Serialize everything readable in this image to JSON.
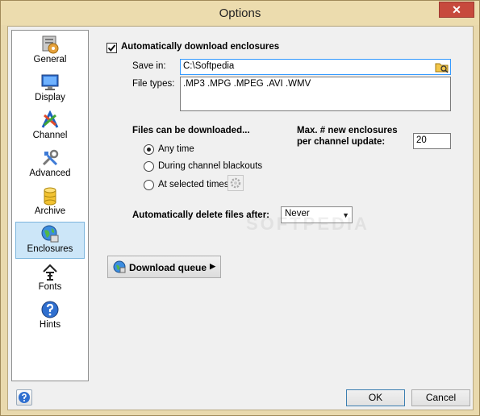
{
  "window": {
    "title": "Options",
    "close_glyph": "✕"
  },
  "sidebar": {
    "items": [
      {
        "label": "General",
        "icon": "general-settings-icon"
      },
      {
        "label": "Display",
        "icon": "monitor-icon"
      },
      {
        "label": "Channel",
        "icon": "channel-icon"
      },
      {
        "label": "Advanced",
        "icon": "tools-icon"
      },
      {
        "label": "Archive",
        "icon": "database-icon"
      },
      {
        "label": "Enclosures",
        "icon": "globe-icon"
      },
      {
        "label": "Fonts",
        "icon": "font-icon"
      },
      {
        "label": "Hints",
        "icon": "question-icon"
      }
    ],
    "selected": "Enclosures"
  },
  "enclosures": {
    "auto_download_label": "Automatically download enclosures",
    "auto_download_checked": true,
    "save_in_label": "Save in:",
    "save_in_value": "C:\\Softpedia",
    "file_types_label": "File types:",
    "file_types_value": ".MP3 .MPG .MPEG .AVI .WMV",
    "files_can_be_downloaded_label": "Files can be downloaded...",
    "options": {
      "any_time": "Any time",
      "during_blackouts": "During channel blackouts",
      "at_selected_times": "At selected times"
    },
    "selected_option": "any_time",
    "max_label_line1": "Max. #  new enclosures",
    "max_label_line2": "per channel update:",
    "max_value": "20",
    "auto_delete_label": "Automatically delete files after:",
    "auto_delete_value": "Never",
    "download_queue_label": "Download queue"
  },
  "watermark": "SOFTPEDIA",
  "footer": {
    "ok_label": "OK",
    "cancel_label": "Cancel"
  },
  "colors": {
    "selected_bg": "#cce6f8",
    "close_red": "#c74a3d",
    "focus_border": "#3399ff"
  }
}
